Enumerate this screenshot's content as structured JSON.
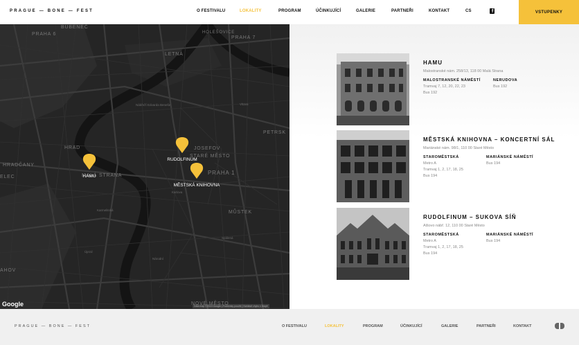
{
  "header": {
    "logo": "PRAGUE — BONE — FEST",
    "nav": [
      {
        "label": "O FESTIVALU"
      },
      {
        "label": "LOKALITY",
        "active": true
      },
      {
        "label": "PROGRAM"
      },
      {
        "label": "ÚČINKUJÍCÍ"
      },
      {
        "label": "GALERIE"
      },
      {
        "label": "PARTNEŘI"
      },
      {
        "label": "KONTAKT"
      },
      {
        "label": "CS"
      }
    ],
    "facebook_icon": "facebook-icon",
    "tickets_label": "VSTUPENKY"
  },
  "map": {
    "districts": [
      "BUBENEČ",
      "PRAHA 6",
      "PRAHA 7",
      "LETNÁ",
      "HOLEŠOVICE",
      "STARÉ MĚSTO",
      "JOSEFOV",
      "PRAHA 1",
      "HRAD",
      "HRADČANY",
      "MALÁ STRANA",
      "PETRSK",
      "MŮSTEK",
      "NOVÉ MĚSTO",
      "AHOV",
      "ELEC"
    ],
    "streets": [
      "Vltava",
      "Nábřeží Edvarda Beneše",
      "Karmelitská",
      "Újezd",
      "Karlova",
      "Národní",
      "Spálená"
    ],
    "markers": [
      {
        "label": "HAMU"
      },
      {
        "label": "RUDOLFINUM"
      },
      {
        "label": "MĚSTSKÁ KNIHOVNA"
      }
    ],
    "google_label": "Google",
    "attribution": "Data map ©2019 Google  |  Podmínky použití  |  Nahlásit chybu v mapě",
    "accent_color": "#f5c13a"
  },
  "venues": [
    {
      "name": "HAMU",
      "address": "Malostranské nám. 258/13, 118 00 Malá Strana",
      "stops": [
        {
          "name": "MALOSTRANSKÉ NÁMĚSTÍ",
          "lines": [
            "Tramvaj 7, 12, 20, 22, 23",
            "Bus 192"
          ]
        },
        {
          "name": "NERUDOVA",
          "lines": [
            "Bus 192"
          ]
        }
      ]
    },
    {
      "name": "MĚSTSKÁ KNIHOVNA – KONCERTNÍ SÁL",
      "address": "Mariánské nám. 98/1, 110 00 Staré Město",
      "stops": [
        {
          "name": "STAROMĚSTSKÁ",
          "lines": [
            "Metro A",
            "Tramvaj 1, 2, 17, 18, 25",
            "Bus 194"
          ]
        },
        {
          "name": "MARIÁNSKÉ NÁMĚSTÍ",
          "lines": [
            "Bus 194"
          ]
        }
      ]
    },
    {
      "name": "RUDOLFINUM – SUKOVA SÍŇ",
      "address": "Alšovo nábř. 12, 110 00 Staré Město",
      "stops": [
        {
          "name": "STAROMĚSTSKÁ",
          "lines": [
            "Metro A",
            "Tramvaj 1, 2, 17, 18, 25",
            "Bus 194"
          ]
        },
        {
          "name": "MARIÁNSKÉ NÁMĚSTÍ",
          "lines": [
            "Bus 194"
          ]
        }
      ]
    }
  ],
  "footer": {
    "logo": "PRAGUE — BONE — FEST",
    "nav": [
      {
        "label": "O FESTIVALU"
      },
      {
        "label": "LOKALITY",
        "active": true
      },
      {
        "label": "PROGRAM"
      },
      {
        "label": "ÚČINKUJÍCÍ"
      },
      {
        "label": "GALERIE"
      },
      {
        "label": "PARTNEŘI"
      },
      {
        "label": "KONTAKT"
      }
    ],
    "icon": "toggle-icon"
  }
}
